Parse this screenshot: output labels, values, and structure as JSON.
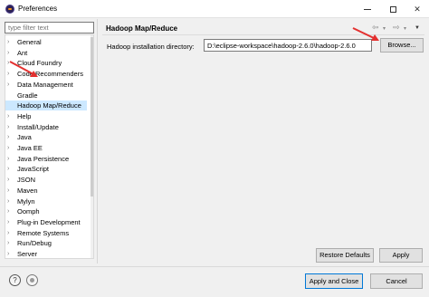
{
  "window": {
    "title": "Preferences",
    "app_icon": "eclipse-icon",
    "controls": [
      "minimize-icon",
      "maximize-icon",
      "close-icon"
    ],
    "close_glyph": "✕"
  },
  "sidebar": {
    "filter_placeholder": "type filter text",
    "items": [
      {
        "label": "General",
        "expandable": true
      },
      {
        "label": "Ant",
        "expandable": true
      },
      {
        "label": "Cloud Foundry",
        "expandable": true
      },
      {
        "label": "Code Recommenders",
        "expandable": true
      },
      {
        "label": "Data Management",
        "expandable": true
      },
      {
        "label": "Gradle",
        "expandable": false
      },
      {
        "label": "Hadoop Map/Reduce",
        "expandable": false,
        "selected": true
      },
      {
        "label": "Help",
        "expandable": true
      },
      {
        "label": "Install/Update",
        "expandable": true
      },
      {
        "label": "Java",
        "expandable": true
      },
      {
        "label": "Java EE",
        "expandable": true
      },
      {
        "label": "Java Persistence",
        "expandable": true
      },
      {
        "label": "JavaScript",
        "expandable": true
      },
      {
        "label": "JSON",
        "expandable": true
      },
      {
        "label": "Maven",
        "expandable": true
      },
      {
        "label": "Mylyn",
        "expandable": true
      },
      {
        "label": "Oomph",
        "expandable": true
      },
      {
        "label": "Plug-in Development",
        "expandable": true
      },
      {
        "label": "Remote Systems",
        "expandable": true
      },
      {
        "label": "Run/Debug",
        "expandable": true
      },
      {
        "label": "Server",
        "expandable": true
      }
    ]
  },
  "page": {
    "title": "Hadoop Map/Reduce",
    "nav_icons": [
      "back-arrow-icon",
      "forward-arrow-icon",
      "view-menu-icon"
    ],
    "install_dir_label": "Hadoop installation directory:",
    "install_dir_value": "D:\\eclipse-workspace\\hadoop-2.6.0\\hadoop-2.6.0",
    "browse_label": "Browse...",
    "restore_defaults_label": "Restore Defaults",
    "apply_label": "Apply"
  },
  "footer": {
    "help_icon": "help-icon",
    "help_glyph": "?",
    "import_icon": "import-export-icon",
    "apply_close_label": "Apply and Close",
    "cancel_label": "Cancel"
  },
  "colors": {
    "annotation_red": "#e3302f",
    "selection": "#cce8ff",
    "default_button_border": "#0078d7"
  }
}
